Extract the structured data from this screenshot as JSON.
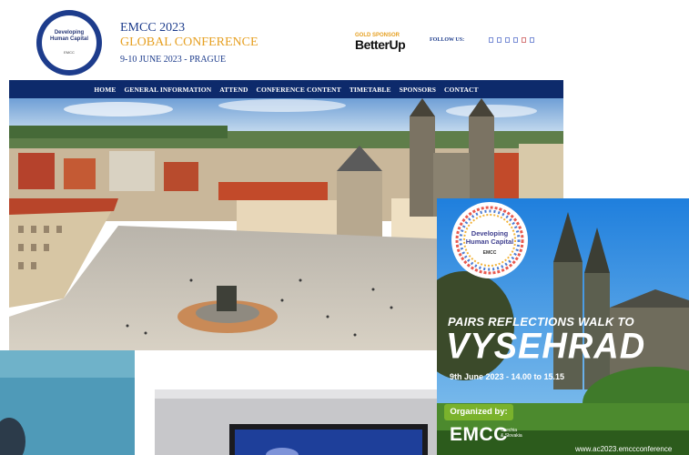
{
  "header": {
    "logo": {
      "line1": "Developing",
      "line2": "Human Capital",
      "badge": "EMCC"
    },
    "title": "EMCC 2023",
    "subtitle": "GLOBAL CONFERENCE",
    "date_location": "9-10 JUNE 2023 - PRAGUE",
    "sponsor_label": "GOLD SPONSOR",
    "sponsor_name": "BetterUp",
    "follow_label": "FOLLOW US:"
  },
  "nav": {
    "items": [
      "HOME",
      "GENERAL INFORMATION",
      "ATTEND",
      "CONFERENCE CONTENT",
      "TIMETABLE",
      "SPONSORS",
      "CONTACT"
    ]
  },
  "promo": {
    "logo_line1": "Developing",
    "logo_line2": "Human Capital",
    "logo_badge": "EMCC",
    "walk_title": "PAIRS REFLECTIONS WALK TO",
    "place": "VYSEHRAD",
    "date_time": "9th June 2023 - 14.00 to 15.15",
    "organized_label": "Organized by:",
    "organizer": "EMCC",
    "organizer_sub_1": "Czechia",
    "organizer_sub_2": "& Slovakia",
    "url": "www.ac2023.emccconference"
  },
  "colors": {
    "brand_navy": "#0d2a6b",
    "brand_blue": "#1d3c8c",
    "brand_gold": "#e6a022",
    "promo_green": "#7ab22c"
  },
  "icons": [
    "social-icon-1",
    "social-icon-2",
    "social-icon-3",
    "social-icon-4",
    "social-icon-5",
    "social-icon-6"
  ]
}
